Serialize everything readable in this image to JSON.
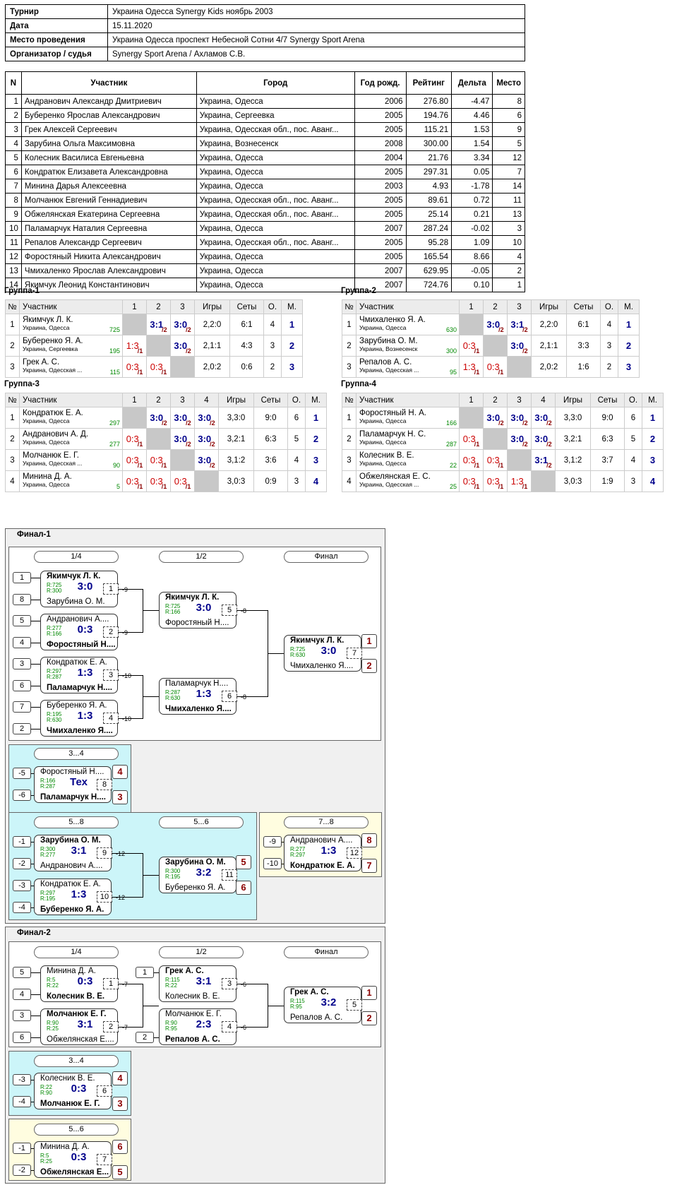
{
  "info": [
    {
      "k": "Турнир",
      "v": "Украина Одесса Synergy Kids ноябрь 2003"
    },
    {
      "k": "Дата",
      "v": "15.11.2020"
    },
    {
      "k": "Место проведения",
      "v": "Украина Одесса проспект Небесной Сотни 4/7 Synergy Sport Arena"
    },
    {
      "k": "Организатор / судья",
      "v": "Synergy Sport Arena / Ахламов С.В."
    }
  ],
  "participants_header": [
    "N",
    "Участник",
    "Город",
    "Год рожд.",
    "Рейтинг",
    "Дельта",
    "Место"
  ],
  "participants": [
    [
      "1",
      "Андранович Александр Дмитриевич",
      "Украина, Одесса",
      "2006",
      "276.80",
      "-4.47",
      "8"
    ],
    [
      "2",
      "Буберенко Ярослав Александрович",
      "Украина, Сергеевка",
      "2005",
      "194.76",
      "4.46",
      "6"
    ],
    [
      "3",
      "Грек Алексей Сергеевич",
      "Украина, Одесская обл., пос. Аванг...",
      "2005",
      "115.21",
      "1.53",
      "9"
    ],
    [
      "4",
      "Зарубина Ольга Максимовна",
      "Украина, Вознесенск",
      "2008",
      "300.00",
      "1.54",
      "5"
    ],
    [
      "5",
      "Колесник Василиса Евгеньевна",
      "Украина, Одесса",
      "2004",
      "21.76",
      "3.34",
      "12"
    ],
    [
      "6",
      "Кондратюк Елизавета Александровна",
      "Украина, Одесса",
      "2005",
      "297.31",
      "0.05",
      "7"
    ],
    [
      "7",
      "Минина Дарья Алексеевна",
      "Украина, Одесса",
      "2003",
      "4.93",
      "-1.78",
      "14"
    ],
    [
      "8",
      "Молчанюк Евгений Геннадиевич",
      "Украина, Одесская обл., пос. Аванг...",
      "2005",
      "89.61",
      "0.72",
      "11"
    ],
    [
      "9",
      "Обжелянская Екатерина Сергеевна",
      "Украина, Одесская обл., пос. Аванг...",
      "2005",
      "25.14",
      "0.21",
      "13"
    ],
    [
      "10",
      "Паламарчук Наталия Сергеевна",
      "Украина, Одесса",
      "2007",
      "287.24",
      "-0.02",
      "3"
    ],
    [
      "11",
      "Репалов Александр Сергеевич",
      "Украина, Одесская обл., пос. Аванг...",
      "2005",
      "95.28",
      "1.09",
      "10"
    ],
    [
      "12",
      "Форостяный Никита Александрович",
      "Украина, Одесса",
      "2005",
      "165.54",
      "8.66",
      "4"
    ],
    [
      "13",
      "Чмихаленко Ярослав Александрович",
      "Украина, Одесса",
      "2007",
      "629.95",
      "-0.05",
      "2"
    ],
    [
      "14",
      "Якимчук Леонид Константинович",
      "Украина, Одесса",
      "2007",
      "724.76",
      "0.10",
      "1"
    ]
  ],
  "group_header": {
    "n": "№",
    "player": "Участник",
    "games": "Игры",
    "sets": "Сеты",
    "points": "О.",
    "place": "М."
  },
  "groups": [
    {
      "title": "Группа-1",
      "rows": [
        {
          "n": "1",
          "name": "Якимчук Л. К.",
          "city": "Украина, Одесса",
          "r": "725",
          "res": [
            null,
            "3:1|2",
            "3:0|2"
          ],
          "games": "2,2:0",
          "sets": "6:1",
          "pts": "4",
          "pl": "1"
        },
        {
          "n": "2",
          "name": "Буберенко Я. А.",
          "city": "Украина, Сергеевка",
          "r": "195",
          "res": [
            "1:3|1",
            null,
            "3:0|2"
          ],
          "games": "2,1:1",
          "sets": "4:3",
          "pts": "3",
          "pl": "2"
        },
        {
          "n": "3",
          "name": "Грек А. С.",
          "city": "Украина, Одесская ...",
          "r": "115",
          "res": [
            "0:3|1",
            "0:3|1",
            null
          ],
          "games": "2,0:2",
          "sets": "0:6",
          "pts": "2",
          "pl": "3"
        }
      ]
    },
    {
      "title": "Группа-2",
      "rows": [
        {
          "n": "1",
          "name": "Чмихаленко Я. А.",
          "city": "Украина, Одесса",
          "r": "630",
          "res": [
            null,
            "3:0|2",
            "3:1|2"
          ],
          "games": "2,2:0",
          "sets": "6:1",
          "pts": "4",
          "pl": "1"
        },
        {
          "n": "2",
          "name": "Зарубина О. М.",
          "city": "Украина, Вознесенск",
          "r": "300",
          "res": [
            "0:3|1",
            null,
            "3:0|2"
          ],
          "games": "2,1:1",
          "sets": "3:3",
          "pts": "3",
          "pl": "2"
        },
        {
          "n": "3",
          "name": "Репалов А. С.",
          "city": "Украина, Одесская ...",
          "r": "95",
          "res": [
            "1:3|1",
            "0:3|1",
            null
          ],
          "games": "2,0:2",
          "sets": "1:6",
          "pts": "2",
          "pl": "3"
        }
      ]
    },
    {
      "title": "Группа-3",
      "rows": [
        {
          "n": "1",
          "name": "Кондратюк Е. А.",
          "city": "Украина, Одесса",
          "r": "297",
          "res": [
            null,
            "3:0|2",
            "3:0|2",
            "3:0|2"
          ],
          "games": "3,3:0",
          "sets": "9:0",
          "pts": "6",
          "pl": "1"
        },
        {
          "n": "2",
          "name": "Андранович А. Д.",
          "city": "Украина, Одесса",
          "r": "277",
          "res": [
            "0:3|1",
            null,
            "3:0|2",
            "3:0|2"
          ],
          "games": "3,2:1",
          "sets": "6:3",
          "pts": "5",
          "pl": "2"
        },
        {
          "n": "3",
          "name": "Молчанюк Е. Г.",
          "city": "Украина, Одесская ...",
          "r": "90",
          "res": [
            "0:3|1",
            "0:3|1",
            null,
            "3:0|2"
          ],
          "games": "3,1:2",
          "sets": "3:6",
          "pts": "4",
          "pl": "3"
        },
        {
          "n": "4",
          "name": "Минина Д. А.",
          "city": "Украина, Одесса",
          "r": "5",
          "res": [
            "0:3|1",
            "0:3|1",
            "0:3|1",
            null
          ],
          "games": "3,0:3",
          "sets": "0:9",
          "pts": "3",
          "pl": "4"
        }
      ]
    },
    {
      "title": "Группа-4",
      "rows": [
        {
          "n": "1",
          "name": "Форостяный Н. А.",
          "city": "Украина, Одесса",
          "r": "166",
          "res": [
            null,
            "3:0|2",
            "3:0|2",
            "3:0|2"
          ],
          "games": "3,3:0",
          "sets": "9:0",
          "pts": "6",
          "pl": "1"
        },
        {
          "n": "2",
          "name": "Паламарчук Н. С.",
          "city": "Украина, Одесса",
          "r": "287",
          "res": [
            "0:3|1",
            null,
            "3:0|2",
            "3:0|2"
          ],
          "games": "3,2:1",
          "sets": "6:3",
          "pts": "5",
          "pl": "2"
        },
        {
          "n": "3",
          "name": "Колесник В. Е.",
          "city": "Украина, Одесса",
          "r": "22",
          "res": [
            "0:3|1",
            "0:3|1",
            null,
            "3:1|2"
          ],
          "games": "3,1:2",
          "sets": "3:7",
          "pts": "4",
          "pl": "3"
        },
        {
          "n": "4",
          "name": "Обжелянская Е. С.",
          "city": "Украина, Одесская ...",
          "r": "25",
          "res": [
            "0:3|1",
            "0:3|1",
            "1:3|1",
            null
          ],
          "games": "3,0:3",
          "sets": "1:9",
          "pts": "3",
          "pl": "4"
        }
      ]
    }
  ],
  "final1": {
    "title": "Финал-1",
    "stages": [
      "1/4",
      "1/2",
      "Финал",
      "3...4",
      "5...8",
      "5...6",
      "7...8"
    ],
    "matches": [
      {
        "p1": "Якимчук Л. К.",
        "r1": "R:725",
        "p2": "Зарубина О. М.",
        "r2": "R:300",
        "s": "3:0",
        "n": "1",
        "w": 1,
        "l": "-9"
      },
      {
        "p1": "Андранович А....",
        "r1": "R:277",
        "p2": "Форостяный Н....",
        "r2": "R:166",
        "s": "0:3",
        "n": "2",
        "w": 2,
        "l": "-9"
      },
      {
        "p1": "Кондратюк Е. А.",
        "r1": "R:297",
        "p2": "Паламарчук Н....",
        "r2": "R:287",
        "s": "1:3",
        "n": "3",
        "w": 2,
        "l": "-10"
      },
      {
        "p1": "Буберенко Я. А.",
        "r1": "R:195",
        "p2": "Чмихаленко Я....",
        "r2": "R:630",
        "s": "1:3",
        "n": "4",
        "w": 2,
        "l": "-10"
      },
      {
        "p1": "Якимчук Л. К.",
        "r1": "R:725",
        "p2": "Форостяный Н....",
        "r2": "R:166",
        "s": "3:0",
        "n": "5",
        "w": 1,
        "l": "-8"
      },
      {
        "p1": "Паламарчук Н....",
        "r1": "R:287",
        "p2": "Чмихаленко Я....",
        "r2": "R:630",
        "s": "1:3",
        "n": "6",
        "w": 2,
        "l": "-8"
      },
      {
        "p1": "Якимчук Л. К.",
        "r1": "R:725",
        "p2": "Чмихаленко Я....",
        "r2": "R:630",
        "s": "3:0",
        "n": "7",
        "w": 1,
        "l": ""
      },
      {
        "p1": "Форостяный Н....",
        "r1": "R:166",
        "p2": "Паламарчук Н....",
        "r2": "R:287",
        "s": "Тех",
        "n": "8",
        "w": 2,
        "l": ""
      },
      {
        "p1": "Зарубина О. М.",
        "r1": "R:300",
        "p2": "Андранович А....",
        "r2": "R:277",
        "s": "3:1",
        "n": "9",
        "w": 1,
        "l": "-12"
      },
      {
        "p1": "Кондратюк Е. А.",
        "r1": "R:297",
        "p2": "Буберенко Я. А.",
        "r2": "R:195",
        "s": "1:3",
        "n": "10",
        "w": 2,
        "l": "-12"
      },
      {
        "p1": "Зарубина О. М.",
        "r1": "R:300",
        "p2": "Буберенко Я. А.",
        "r2": "R:195",
        "s": "3:2",
        "n": "11",
        "w": 1,
        "l": ""
      },
      {
        "p1": "Андранович А....",
        "r1": "R:277",
        "p2": "Кондратюк Е. А.",
        "r2": "R:297",
        "s": "1:3",
        "n": "12",
        "w": 2,
        "l": ""
      }
    ],
    "seeds": [
      "1",
      "8",
      "5",
      "4",
      "3",
      "6",
      "7",
      "2",
      "-5",
      "-6",
      "-1",
      "-2",
      "-3",
      "-4",
      "-9",
      "-10"
    ],
    "places": [
      "1",
      "2",
      "4",
      "3",
      "5",
      "6",
      "8",
      "7"
    ]
  },
  "final2": {
    "title": "Финал-2",
    "stages": [
      "1/4",
      "1/2",
      "Финал",
      "3...4",
      "5...6"
    ],
    "matches": [
      {
        "p1": "Минина Д. А.",
        "r1": "R:5",
        "p2": "Колесник В. Е.",
        "r2": "R:22",
        "s": "0:3",
        "n": "1",
        "w": 2,
        "l": "-7"
      },
      {
        "p1": "Молчанюк Е. Г.",
        "r1": "R:90",
        "p2": "Обжелянская Е....",
        "r2": "R:25",
        "s": "3:1",
        "n": "2",
        "w": 1,
        "l": "-7"
      },
      {
        "p1": "Грек А. С.",
        "r1": "R:115",
        "p2": "Колесник В. Е.",
        "r2": "R:22",
        "s": "3:1",
        "n": "3",
        "w": 1,
        "l": "-6"
      },
      {
        "p1": "Молчанюк Е. Г.",
        "r1": "R:90",
        "p2": "Репалов А. С.",
        "r2": "R:95",
        "s": "2:3",
        "n": "4",
        "w": 2,
        "l": "-6"
      },
      {
        "p1": "Грек А. С.",
        "r1": "R:115",
        "p2": "Репалов А. С.",
        "r2": "R:95",
        "s": "3:2",
        "n": "5",
        "w": 1,
        "l": ""
      },
      {
        "p1": "Колесник В. Е.",
        "r1": "R:22",
        "p2": "Молчанюк Е. Г.",
        "r2": "R:90",
        "s": "0:3",
        "n": "6",
        "w": 2,
        "l": ""
      },
      {
        "p1": "Минина Д. А.",
        "r1": "R:5",
        "p2": "Обжелянская Е....",
        "r2": "R:25",
        "s": "0:3",
        "n": "7",
        "w": 2,
        "l": ""
      }
    ],
    "seeds": [
      "5",
      "4",
      "3",
      "6",
      "1",
      "2",
      "-3",
      "-4",
      "-1",
      "-2"
    ],
    "places": [
      "1",
      "2",
      "4",
      "3",
      "6",
      "5"
    ]
  }
}
